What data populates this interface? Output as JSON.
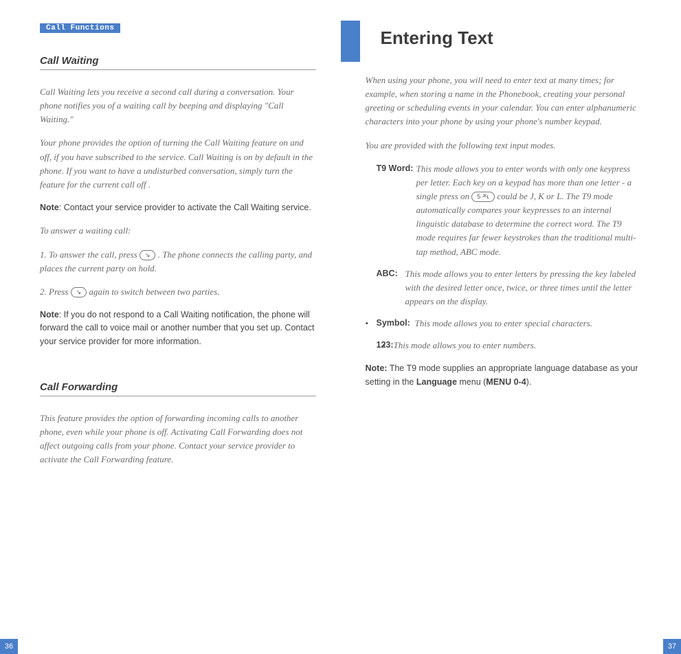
{
  "left": {
    "section_tab": "Call Functions",
    "heading1": "Call Waiting",
    "p1": "Call Waiting lets you receive a second call during a conversation. Your phone notifies you of a waiting call by beeping and displaying \"Call Waiting.\"",
    "p2": "Your phone provides the option of turning the Call Waiting feature on and off, if you have subscribed to the service. Call Waiting is on by default in the phone. If you want to have a undisturbed conversation, simply turn the feature for the current call off .",
    "note1_label": "Note",
    "note1_text": ": Contact your service provider to activate the Call Waiting service.",
    "p3": "To answer a waiting call:",
    "step1_a": "1. To answer the call, press ",
    "step1_b": " . The phone connects the calling party, and places the current party on hold.",
    "step2_a": "2. Press  ",
    "step2_b": "  again to switch between two parties.",
    "note2_label": "Note",
    "note2_text": ": If you do not respond to a Call Waiting notification, the phone will forward the call to voice mail or another number that you set up. Contact your service provider for more information.",
    "heading2": "Call Forwarding",
    "p4": "This feature provides the option of forwarding incoming calls to another phone, even while your phone is off. Activating Call Forwarding does not affect outgoing calls from your phone. Contact your service provider to activate the Call Forwarding feature.",
    "page_num": "36"
  },
  "right": {
    "chapter_title": "Entering Text",
    "intro": "When using your phone, you will need to enter text at many times; for example, when storing a name in the Phonebook, creating your personal greeting or scheduling events in your calendar. You can enter alphanumeric characters into your phone by using your phone's number keypad.",
    "modes_intro": "You are provided with the following text input modes.",
    "t9_label": "T9 Word:",
    "t9_a": " This mode allows you to enter words with only one keypress per letter. Each key on a keypad has more than one letter - a single press on ",
    "t9_key": "5 ᴶᴷʟ",
    "t9_b": " could be J, K or L. The T9 mode automatically compares your keypresses to an internal linguistic database to determine the correct word. The T9 mode requires far fewer keystrokes than the traditional multi-tap method, ABC mode.",
    "abc_label": "ABC:",
    "abc_text": " This mode allows you to enter letters by pressing the key labeled with the desired letter once, twice, or three times until the letter appears on the display.",
    "symbol_label": "Symbol:",
    "symbol_text": " This mode allows you to enter special characters.",
    "num_label": "123:",
    "num_text": " This mode allows you to enter numbers.",
    "note_label": "Note:",
    "note_a": " The T9 mode supplies an appropriate language database as your setting in the ",
    "note_lang": "Language",
    "note_b": " menu (",
    "note_menu": "MENU 0-4",
    "note_c": ").",
    "page_num": "37"
  },
  "icons": {
    "send_key": "↘"
  }
}
